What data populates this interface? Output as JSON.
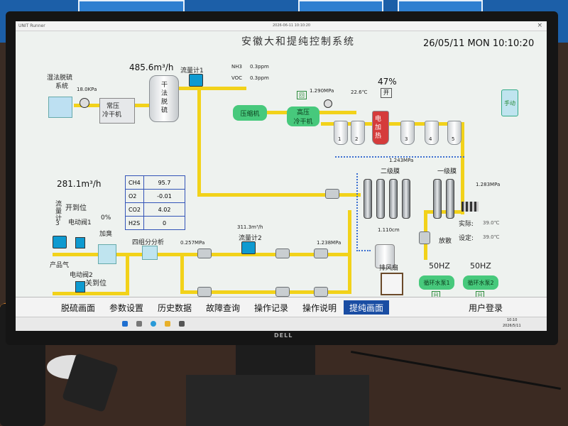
{
  "screen": {
    "window_title": "UNIT Runner",
    "window_clock": "2026-06-11 10:10:20",
    "system_title": "安徽大和提纯控制系统",
    "datetime": "26/05/11 MON 10:10:20",
    "close_glyph": "×"
  },
  "left": {
    "desulf_label_line1": "湿法脱硫",
    "desulf_label_line2": "系统",
    "pressure_1": "18.0KPa",
    "cooler_label_line1": "常压",
    "cooler_label_line2": "冷干机",
    "flow_total": "485.6m³/h",
    "dry_desulf_line1": "干",
    "dry_desulf_line2": "法",
    "dry_desulf_line3": "脱",
    "dry_desulf_line4": "硫",
    "flowmeter1": "流量计1",
    "nh3": "NH3",
    "nh3_val": "0.3ppm",
    "voc": "VOC",
    "voc_val": "0.3ppm",
    "flow_281": "281.1m³/h",
    "flow_meter3_l1": "流",
    "flow_meter3_l2": "量",
    "flow_meter3_l3": "计",
    "flow_meter3_l4": "3",
    "open_status": "开到位",
    "valve1": "电动阀1",
    "percent0": "0%",
    "deodor": "加臭",
    "product_gas": "产品气",
    "valve2": "电动阀2",
    "close_status": "关到位",
    "vent": "放散"
  },
  "gas_table": {
    "rows": [
      {
        "name": "CH4",
        "value": "95.7"
      },
      {
        "name": "O2",
        "value": "-0.01"
      },
      {
        "name": "CO2",
        "value": "4.02"
      },
      {
        "name": "H2S",
        "value": "0"
      }
    ]
  },
  "middle": {
    "analyzer": "四组分分析",
    "press_0257": "0.257MPa",
    "flow_3113": "311.3m³/h",
    "flowmeter2": "流量计2",
    "press_1238": "1.238MPa",
    "compressor": "压缩机",
    "hp_cooler_line1": "高压",
    "hp_cooler_line2": "冷干机",
    "hp_cooler_tag": "回",
    "press_1290": "1.290MPa",
    "temp_226": "22.6℃",
    "percent47": "47%",
    "heater_line1": "电",
    "heater_line2": "加",
    "heater_line3": "热",
    "heater_tag": "开",
    "press_1243": "1.243MPa",
    "press_1110": "1.110cm",
    "vessel_labels": [
      "1",
      "2",
      "3",
      "4",
      "5"
    ]
  },
  "right": {
    "membrane2": "二级膜",
    "membrane1": "一级膜",
    "press_1283": "1.283MPa",
    "actual_label": "实际:",
    "actual_val": "39.0℃",
    "setpoint_label": "设定:",
    "setpoint_val": "39.0℃",
    "vent2": "放散",
    "fan": "排风扇",
    "hz1": "50HZ",
    "hz2": "50HZ",
    "pump1": "循环水泵1",
    "pump2": "循环水泵2",
    "pump_tag": "回",
    "mode_manual": "手动"
  },
  "nav": {
    "items": [
      "脱硫画面",
      "参数设置",
      "历史数据",
      "故障查询",
      "操作记录",
      "操作说明",
      "提纯画面"
    ],
    "active": "提纯画面",
    "login": "用户登录"
  },
  "taskbar": {
    "time": "10:10",
    "date": "2026/5/11"
  },
  "colors": {
    "pipe": "#f2d21a",
    "nav_active": "#1a4da3",
    "green_equipment": "#47c97c",
    "sensor_blue": "#0e9ad0"
  },
  "bezel_brand": "DELL"
}
